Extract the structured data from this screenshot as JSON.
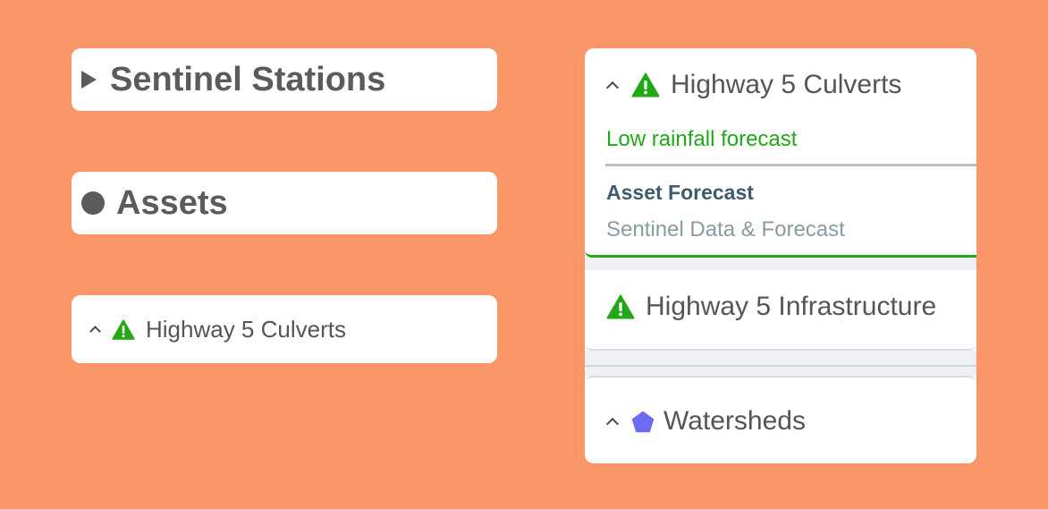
{
  "left_cards": {
    "stations": {
      "label": "Sentinel Stations",
      "icon": "caret-right-icon"
    },
    "assets": {
      "label": "Assets",
      "icon": "circle-icon"
    },
    "culverts": {
      "label": "Highway 5 Culverts",
      "icon": "warning-triangle-icon",
      "expanded": true
    }
  },
  "panel": {
    "culverts": {
      "title": "Highway 5 Culverts",
      "status": "Low rainfall forecast",
      "link_title": "Asset Forecast",
      "link_subtitle": "Sentinel Data & Forecast"
    },
    "infrastructure": {
      "title": "Highway 5 Infrastructure"
    },
    "watersheds": {
      "title": "Watersheds",
      "icon": "pentagon-icon"
    }
  },
  "colors": {
    "background": "#fa9768",
    "warning_green": "#22a816",
    "pentagon": "#6b6bf5",
    "link_title": "#3e5c6e",
    "subtitle_grey": "#8c9aa3"
  }
}
